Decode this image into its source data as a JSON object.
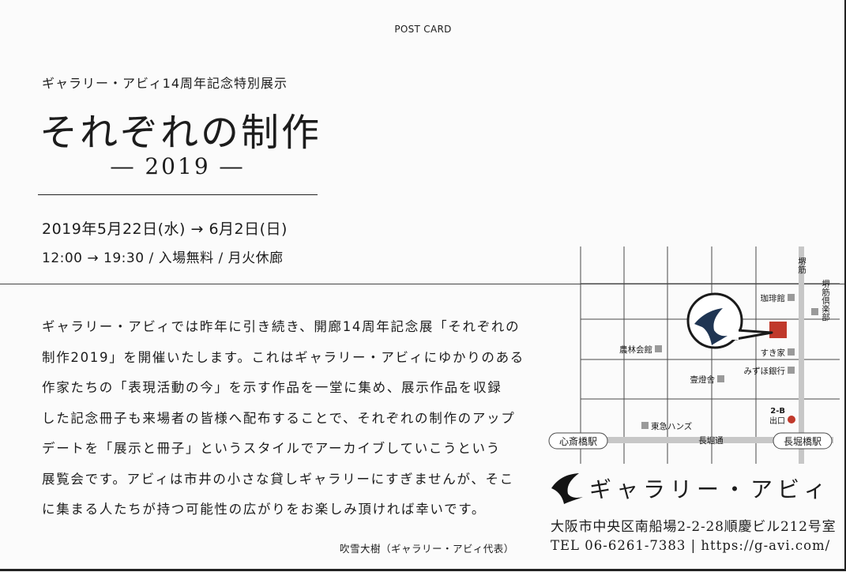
{
  "header": {
    "postcard": "POST CARD",
    "subtitle": "ギャラリー・アビィ14周年記念特別展示",
    "title": "それぞれの制作",
    "year": "― 2019 ―"
  },
  "schedule": {
    "dates": "2019年5月22日(水) → 6月2日(日)",
    "hours": "12:00 → 19:30 / 入場無料 / 月火休廊"
  },
  "body": {
    "lines": [
      "ギャラリー・アビィでは昨年に引き続き、開廊14周年記念展「それぞれの",
      "制作2019」を開催いたします。これはギャラリー・アビィにゆかりのある",
      "作家たちの「表現活動の今」を示す作品を一堂に集め、展示作品を収録",
      "した記念冊子も来場者の皆様へ配布することで、それぞれの制作のアップ",
      "デートを「展示と冊子」というスタイルでアーカイブしていこうという",
      "展覧会です。アビィは市井の小さな貸しギャラリーにすぎませんが、そこ",
      "に集まる人たちが持つ可能性の広がりをお楽しみ頂ければ幸いです。"
    ],
    "signature": "吹雪大樹（ギャラリー・アビィ代表）"
  },
  "map": {
    "sakaisuji_vertical": "堺筋",
    "sakaisuji_club": "堺筋倶楽部",
    "coffee": "珈琲館",
    "sukiya": "すき家",
    "mizuho": "みずほ銀行",
    "norin": "農林会館",
    "itoya": "壹燈舎",
    "exit_number": "2-B",
    "exit_label": "出口",
    "tokyu_hands": "東急ハンズ",
    "nagahori_dori": "長堀通",
    "shinsaibashi_station": "心斎橋駅",
    "nagahoribashi_station": "長堀橋駅",
    "accent_color": "#c0392b",
    "logo_color": "#1f3553"
  },
  "gallery": {
    "name": "ギャラリー・アビィ",
    "address": "大阪市中央区南船場2-2-28順慶ビル212号室",
    "contact": "TEL 06-6261-7383 | https://g-avi.com/"
  }
}
